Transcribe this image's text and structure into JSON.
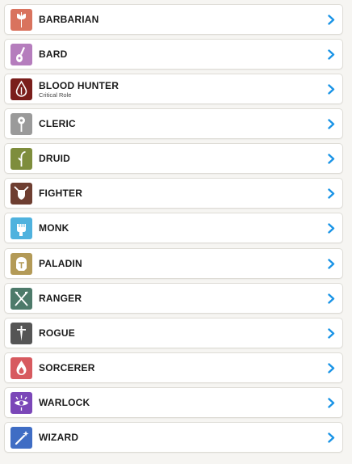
{
  "classes": [
    {
      "name": "BARBARIAN",
      "subtitle": "",
      "color": "#d9735e",
      "icon": "axe-icon"
    },
    {
      "name": "BARD",
      "subtitle": "",
      "color": "#b57dbd",
      "icon": "lute-icon"
    },
    {
      "name": "BLOOD HUNTER",
      "subtitle": "Critical Role",
      "color": "#7a1e1b",
      "icon": "blood-drop-icon"
    },
    {
      "name": "CLERIC",
      "subtitle": "",
      "color": "#9a9a9a",
      "icon": "mace-icon"
    },
    {
      "name": "DRUID",
      "subtitle": "",
      "color": "#7e8d3c",
      "icon": "sprout-icon"
    },
    {
      "name": "FIGHTER",
      "subtitle": "",
      "color": "#6e3e31",
      "icon": "shield-swords-icon"
    },
    {
      "name": "MONK",
      "subtitle": "",
      "color": "#4fb2de",
      "icon": "fist-icon"
    },
    {
      "name": "PALADIN",
      "subtitle": "",
      "color": "#b39a57",
      "icon": "helmet-icon"
    },
    {
      "name": "RANGER",
      "subtitle": "",
      "color": "#4d7a6a",
      "icon": "arrows-icon"
    },
    {
      "name": "ROGUE",
      "subtitle": "",
      "color": "#555555",
      "icon": "dagger-icon"
    },
    {
      "name": "SORCERER",
      "subtitle": "",
      "color": "#d75a5f",
      "icon": "flame-icon"
    },
    {
      "name": "WARLOCK",
      "subtitle": "",
      "color": "#7b47b8",
      "icon": "eye-icon"
    },
    {
      "name": "WIZARD",
      "subtitle": "",
      "color": "#3f6dc4",
      "icon": "wand-icon"
    }
  ],
  "chevron_color": "#1a94e6"
}
